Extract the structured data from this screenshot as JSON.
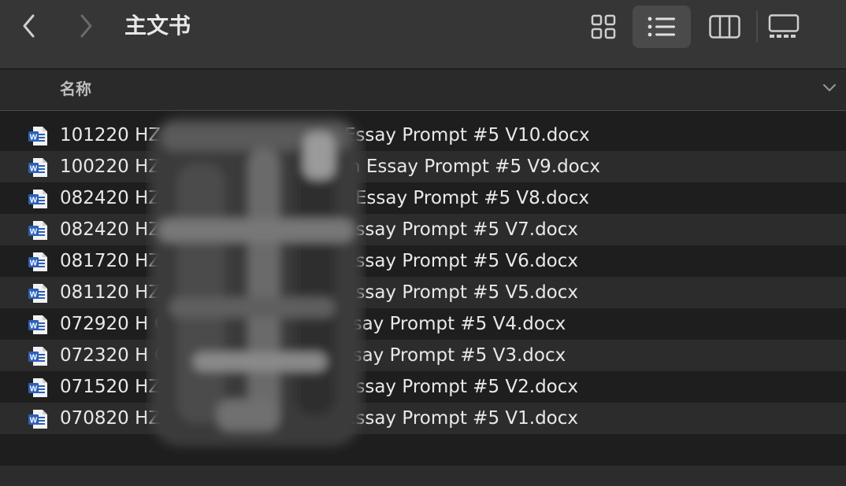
{
  "toolbar": {
    "back_icon": "chevron-left-icon",
    "forward_icon": "chevron-right-icon",
    "title": "主文书",
    "view_buttons": [
      {
        "name": "icon-view",
        "icon": "grid-icon",
        "active": false
      },
      {
        "name": "list-view",
        "icon": "list-icon",
        "active": true
      },
      {
        "name": "column-view",
        "icon": "columns-icon",
        "active": false
      },
      {
        "name": "gallery-view",
        "icon": "gallery-icon",
        "active": false
      }
    ]
  },
  "header": {
    "name_column": "名称",
    "sort_icon": "chevron-down-icon"
  },
  "files": [
    {
      "name": "101220 HZ Common App Main Essay Prompt #5 V10.docx",
      "icon": "word-doc-icon"
    },
    {
      "name": "100220 HZTA Common App Main Essay Prompt #5 V9.docx",
      "icon": "word-doc-icon"
    },
    {
      "name": "082420 HZT Common App Main Essay Prompt #5 V8.docx",
      "icon": "word-doc-icon"
    },
    {
      "name": "082420 HZ Common App Main Essay Prompt #5 V7.docx",
      "icon": "word-doc-icon"
    },
    {
      "name": "081720 HZ Common App Main Essay Prompt #5 V6.docx",
      "icon": "word-doc-icon"
    },
    {
      "name": "081120 HZ Common App Main Essay Prompt #5 V5.docx",
      "icon": "word-doc-icon"
    },
    {
      "name": "072920 H Common App Main Essay Prompt #5 V4.docx",
      "icon": "word-doc-icon"
    },
    {
      "name": "072320 H Common App Main Essay Prompt #5 V3.docx",
      "icon": "word-doc-icon"
    },
    {
      "name": "071520 HZ Common App Main Essay Prompt #5 V2.docx",
      "icon": "word-doc-icon"
    },
    {
      "name": "070820 HZ Common App Main Essay Prompt #5 V1.docx",
      "icon": "word-doc-icon"
    }
  ],
  "colors": {
    "toolbar_bg": "#363636",
    "window_bg": "#1e1e1e",
    "row_alt_bg": "#2c2c2c",
    "word_blue": "#2b5fb8"
  }
}
